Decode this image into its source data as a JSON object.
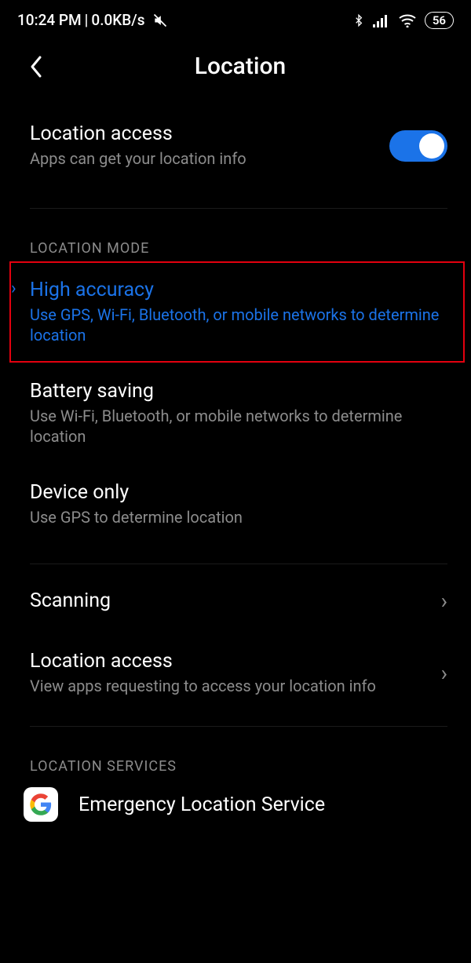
{
  "status": {
    "time": "10:24 PM",
    "sep": " | ",
    "speed": "0.0KB/s",
    "battery": "56"
  },
  "header": {
    "title": "Location"
  },
  "location_access": {
    "title": "Location access",
    "subtitle": "Apps can get your location info",
    "toggle_on": true
  },
  "section_mode_label": "LOCATION MODE",
  "modes": {
    "high_accuracy": {
      "title": "High accuracy",
      "subtitle": "Use GPS, Wi-Fi, Bluetooth, or mobile networks to determine location",
      "selected": true
    },
    "battery_saving": {
      "title": "Battery saving",
      "subtitle": "Use Wi-Fi, Bluetooth, or mobile networks to determine location"
    },
    "device_only": {
      "title": "Device only",
      "subtitle": "Use GPS to determine location"
    }
  },
  "scanning": {
    "title": "Scanning"
  },
  "location_access_apps": {
    "title": "Location access",
    "subtitle": "View apps requesting to access your location info"
  },
  "section_services_label": "LOCATION SERVICES",
  "els": {
    "title": "Emergency Location Service"
  }
}
